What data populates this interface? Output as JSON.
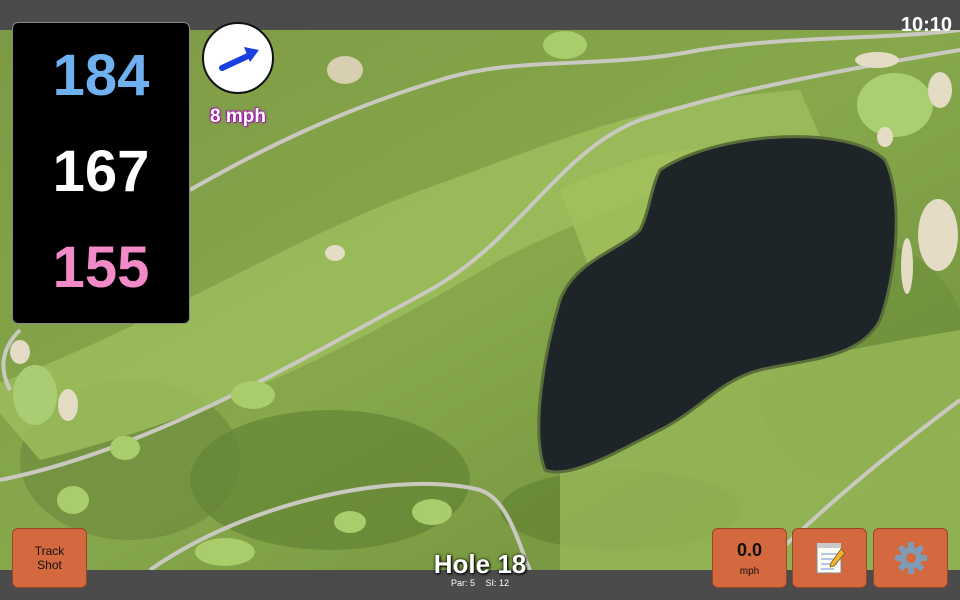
{
  "status": {
    "time": "10:10"
  },
  "distances": {
    "back": "184",
    "middle": "167",
    "front": "155"
  },
  "wind": {
    "speed_label": "8 mph",
    "direction": "arrow-east-northeast"
  },
  "buttons": {
    "track_shot_line1": "Track",
    "track_shot_line2": "Shot",
    "speed_value": "0.0",
    "speed_unit": "mph",
    "notes_icon": "notepad-icon",
    "settings_icon": "gear-icon"
  },
  "hole": {
    "title": "Hole 18",
    "par": "Par: 5",
    "si": "SI: 12"
  },
  "colors": {
    "back": "#6fb1f0",
    "middle": "#ffffff",
    "front": "#f28ac7",
    "button": "#d4683e",
    "water": "#1d2428",
    "fairway": "#8cb04e",
    "rough": "#6f8f3b"
  }
}
